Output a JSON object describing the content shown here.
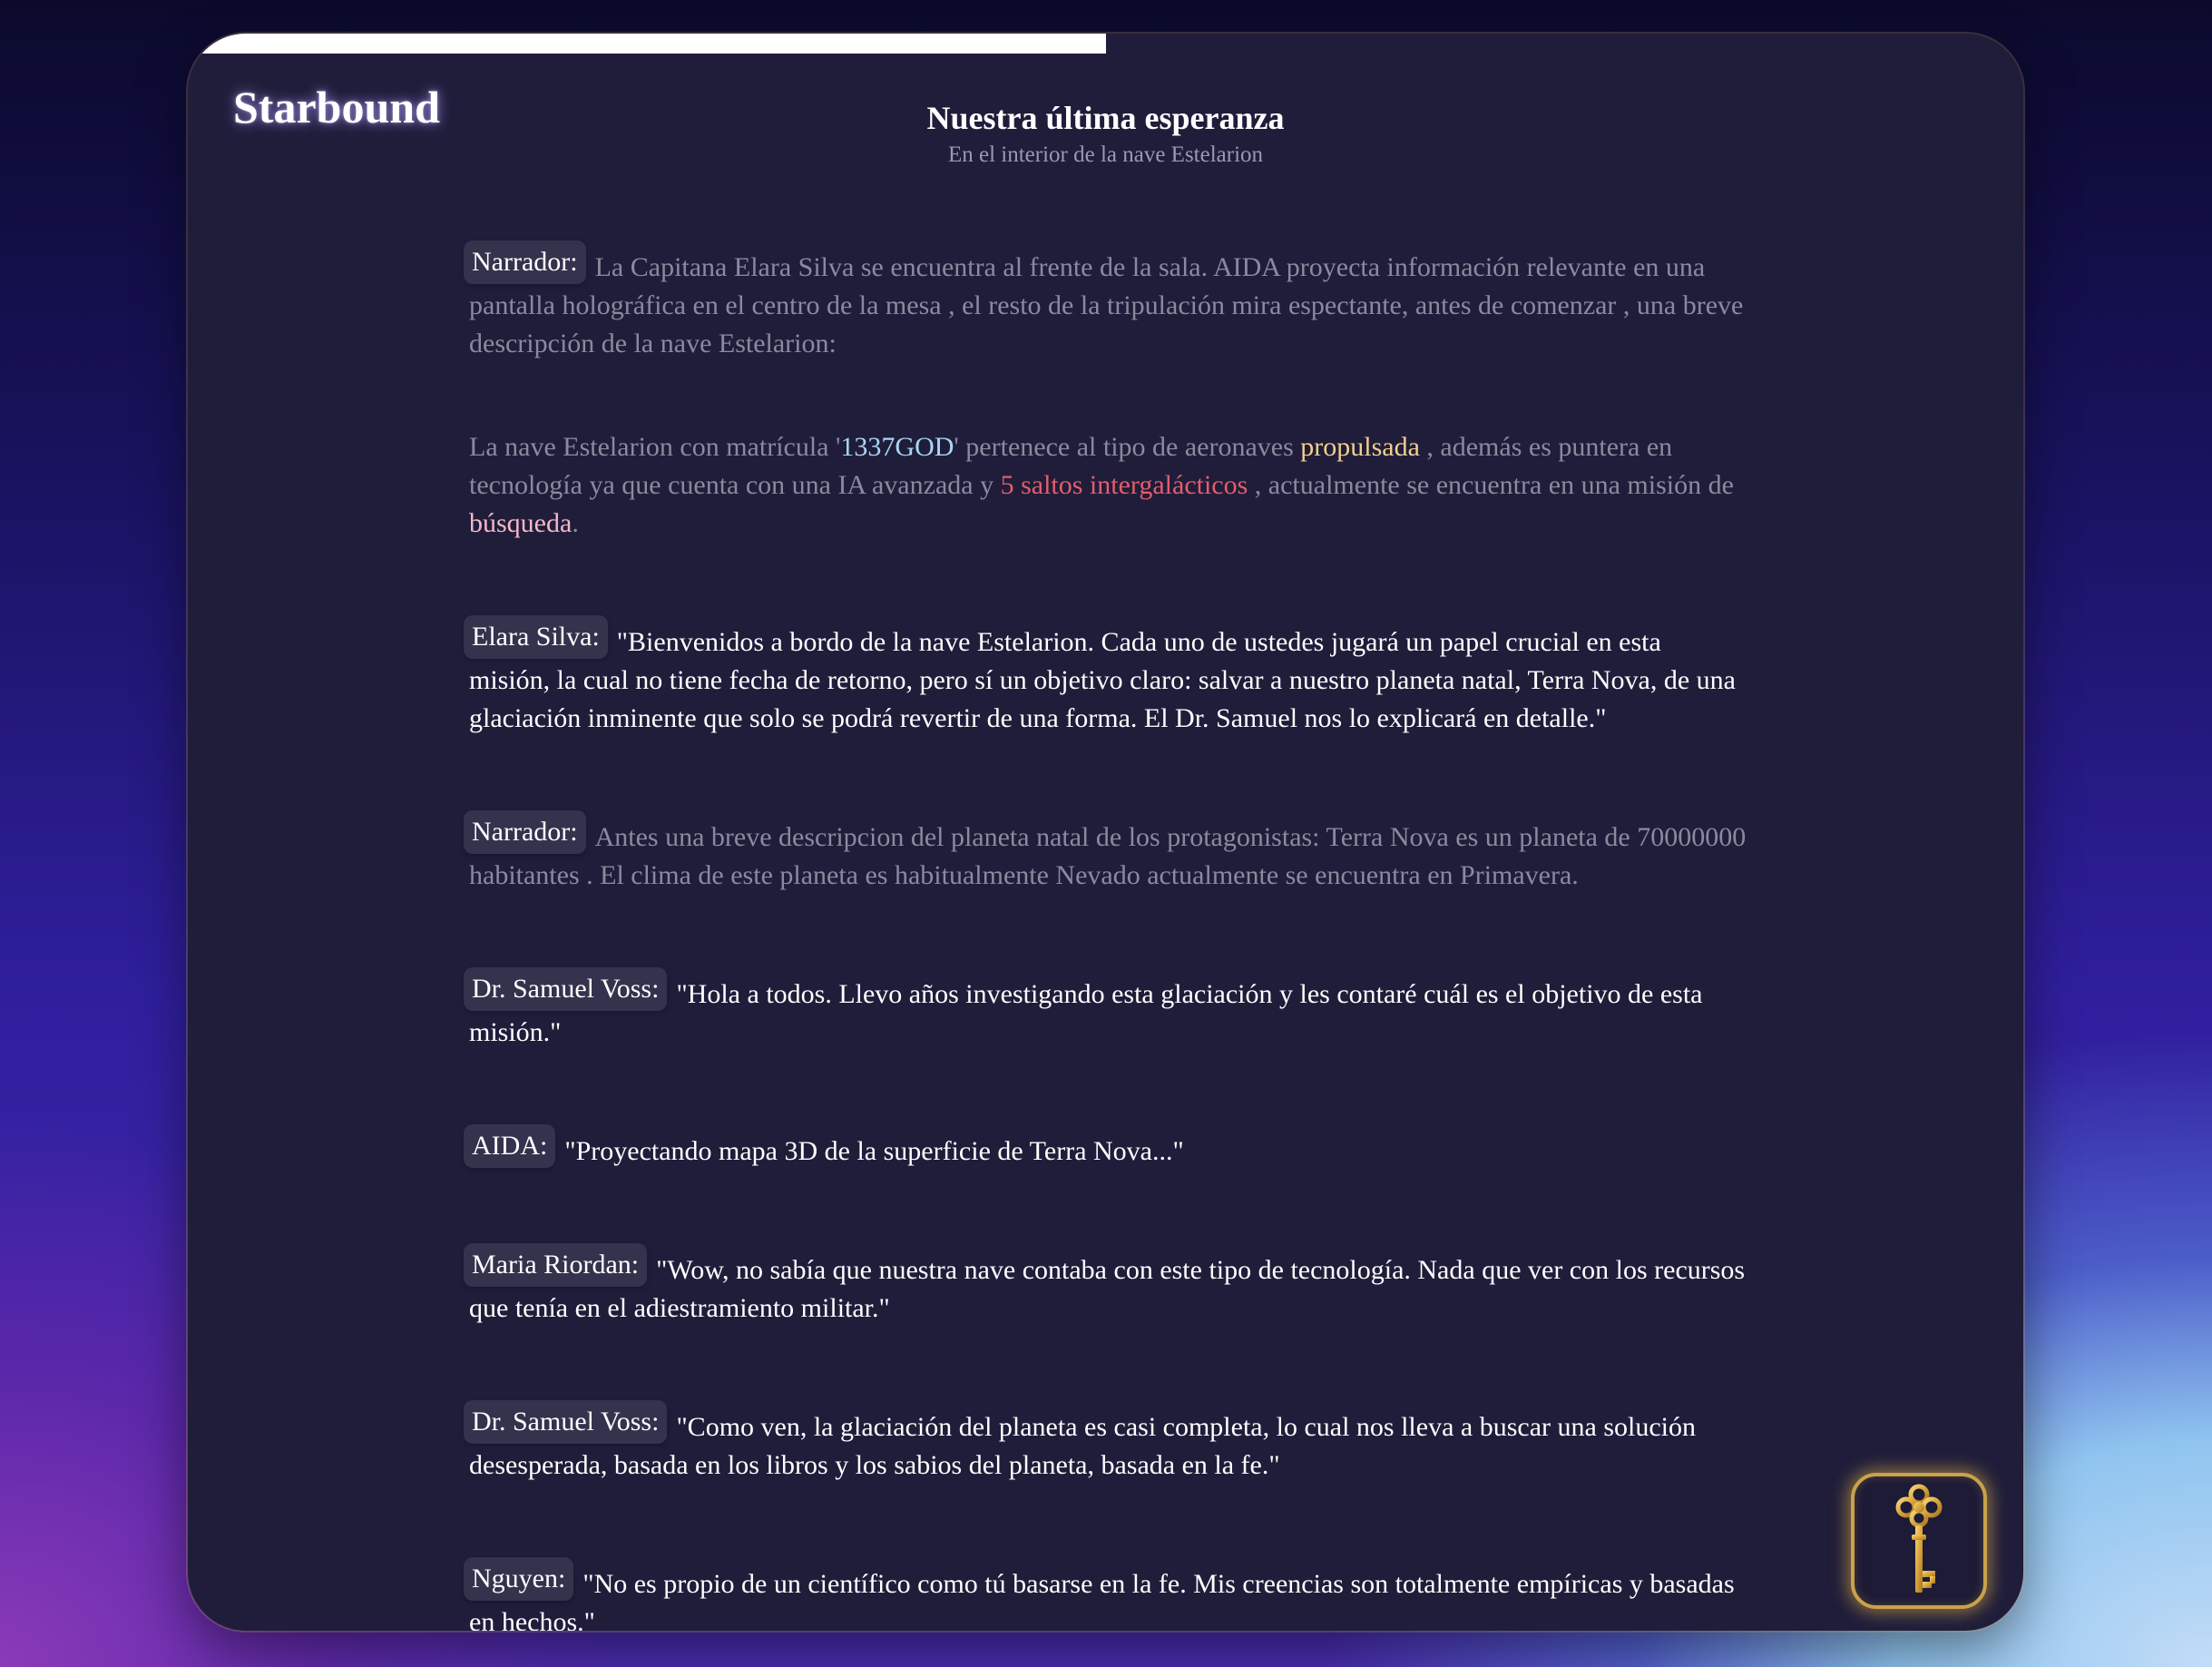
{
  "app": {
    "brand": "Starbound",
    "progress_fraction": 0.5
  },
  "scene": {
    "title": "Nuestra última esperanza",
    "subtitle": "En el interior de la nave Estelarion"
  },
  "dialogue": [
    {
      "speaker": "Narrador:",
      "type": "narration",
      "text": "La Capitana Elara Silva se encuentra al frente de la sala. AIDA proyecta información relevante en una pantalla holográfica en el centro de la mesa , el resto de la tripulación mira espectante, antes de comenzar , una breve descripción de la nave Estelarion:"
    },
    {
      "type": "ship_info",
      "pre": "La nave Estelarion con matrícula '",
      "plate": "1337GOD",
      "mid1": "' pertenece al tipo de aeronaves ",
      "propulsion": "propulsada",
      "mid2": " , además es puntera en tecnología ya que cuenta con una IA avanzada y ",
      "jumps": "5 saltos intergalácticos",
      "mid3": " , actualmente se encuentra en una misión de ",
      "mission": "búsqueda",
      "end": "."
    },
    {
      "speaker": "Elara Silva:",
      "type": "speech",
      "text": "\"Bienvenidos a bordo de la nave Estelarion. Cada uno de ustedes jugará un papel crucial en esta misión, la cual no tiene fecha de retorno, pero sí un objetivo claro: salvar a nuestro planeta natal, Terra Nova, de una glaciación inminente que solo se podrá revertir de una forma. El Dr. Samuel nos lo explicará en detalle.\""
    },
    {
      "speaker": "Narrador:",
      "type": "narration",
      "text": "Antes una breve descripcion del planeta natal de los protagonistas: Terra Nova es un planeta de 70000000 habitantes . El clima de este planeta es habitualmente Nevado actualmente se encuentra en Primavera."
    },
    {
      "speaker": "Dr. Samuel Voss:",
      "type": "speech",
      "text": "\"Hola a todos. Llevo años investigando esta glaciación y les contaré cuál es el objetivo de esta misión.\""
    },
    {
      "speaker": "AIDA:",
      "type": "speech",
      "text": "\"Proyectando mapa 3D de la superficie de Terra Nova...\""
    },
    {
      "speaker": "Maria Riordan:",
      "type": "speech",
      "text": "\"Wow, no sabía que nuestra nave contaba con este tipo de tecnología. Nada que ver con los recursos que tenía en el adiestramiento militar.\""
    },
    {
      "speaker": "Dr. Samuel Voss:",
      "type": "speech",
      "text": "\"Como ven, la glaciación del planeta es casi completa, lo cual nos lleva a buscar una solución desesperada, basada en los libros y los sabios del planeta, basada en la fe.\""
    },
    {
      "speaker": "Nguyen:",
      "type": "speech",
      "text": "\"No es propio de un científico como tú basarse en la fe. Mis creencias son totalmente empíricas y basadas en hechos.\""
    }
  ],
  "key_button": {
    "icon": "key-icon"
  },
  "colors": {
    "card_bg": "#1f1d3a",
    "speaker_badge_bg": "#34324c",
    "narration_text": "#8b8a9d",
    "plate": "#a9d6f5",
    "propulsion": "#f3cf8d",
    "jumps": "#e45d6b",
    "mission": "#f5b8c8",
    "key_gold": "#c9a24a"
  }
}
